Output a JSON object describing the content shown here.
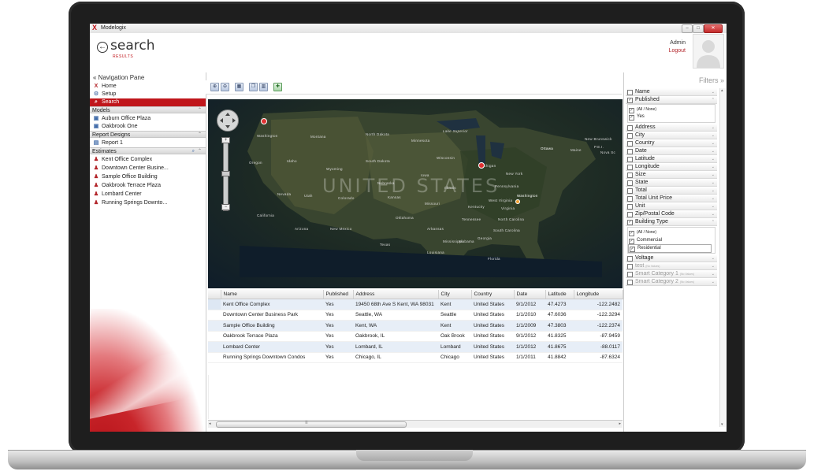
{
  "window": {
    "title": "Modelogix",
    "min": "–",
    "max": "□",
    "close": "✕"
  },
  "header": {
    "title": "search",
    "subtitle": "RESULTS",
    "user": "Admin",
    "logout": "Logout"
  },
  "nav": {
    "pane_title": "« Navigation Pane",
    "top_items": [
      {
        "label": "Home"
      },
      {
        "label": "Setup"
      },
      {
        "label": "Search"
      }
    ],
    "models_header": "Models",
    "models": [
      {
        "label": "Auburn Office Plaza"
      },
      {
        "label": "Oakbrook One"
      }
    ],
    "report_header": "Report Designs",
    "reports": [
      {
        "label": "Report 1"
      }
    ],
    "estimates_header": "Estimates",
    "estimates": [
      {
        "label": "Kent Office Complex"
      },
      {
        "label": "Downtown Center Busine..."
      },
      {
        "label": "Sample Office Building"
      },
      {
        "label": "Oakbrook Terrace Plaza"
      },
      {
        "label": "Lombard Center"
      },
      {
        "label": "Running Springs Downto..."
      }
    ]
  },
  "map": {
    "watermark": "UNITED STATES",
    "labels": {
      "washington": "Washington",
      "montana": "Montana",
      "north_dakota": "North Dakota",
      "minnesota": "Minnesota",
      "oregon": "Oregon",
      "idaho": "Idaho",
      "south_dakota": "South Dakota",
      "wisconsin": "Wisconsin",
      "michigan": "Michigan",
      "wyoming": "Wyoming",
      "iowa": "Iowa",
      "nebraska": "Nebraska",
      "illinois": "Illinois",
      "nevada": "Nevada",
      "utah": "Utah",
      "colorado": "Colorado",
      "kansas": "Kansas",
      "missouri": "Missouri",
      "kentucky": "Kentucky",
      "california": "California",
      "arizona": "Arizona",
      "new_mexico": "New Mexico",
      "oklahoma": "Oklahoma",
      "arkansas": "Arkansas",
      "tennessee": "Tennessee",
      "texas": "Texas",
      "louisiana": "Louisiana",
      "mississippi": "Mississippi",
      "alabama": "Alabama",
      "georgia": "Georgia",
      "florida": "Florida",
      "north_carolina": "North Carolina",
      "south_carolina": "South Carolina",
      "virginia": "Virginia",
      "pennsylvania": "Pennsylvania",
      "new_york": "New York",
      "maine": "Maine",
      "ottawa": "Ottawa",
      "lake_superior": "Lake Superior",
      "washington_dc": "Washington",
      "west_virginia": "West Virginia",
      "new_brunswick": "New Brunswick",
      "nova_scotia": "Nova Sc",
      "pei": "P.E.I."
    }
  },
  "grid": {
    "columns": [
      "Name",
      "Published",
      "Address",
      "City",
      "Country",
      "Date",
      "Latitude",
      "Longitude"
    ],
    "rows": [
      [
        "Kent Office Complex",
        "Yes",
        "19450 68th Ave S Kent, WA 98031",
        "Kent",
        "United States",
        "9/1/2012",
        "47.4273",
        "-122.2482"
      ],
      [
        "Downtown Center Business Park",
        "Yes",
        "Seattle, WA",
        "Seattle",
        "United States",
        "1/1/2010",
        "47.6036",
        "-122.3294"
      ],
      [
        "Sample Office Building",
        "Yes",
        "Kent, WA",
        "Kent",
        "United States",
        "1/1/2009",
        "47.3803",
        "-122.2374"
      ],
      [
        "Oakbrook Terrace Plaza",
        "Yes",
        "Oakbrook, IL",
        "Oak Brook",
        "United States",
        "9/1/2012",
        "41.8325",
        "-87.9459"
      ],
      [
        "Lombard Center",
        "Yes",
        "Lombard, IL",
        "Lombard",
        "United States",
        "1/1/2012",
        "41.8675",
        "-88.0117"
      ],
      [
        "Running Springs Downtown Condos",
        "Yes",
        "Chicago, IL",
        "Chicago",
        "United States",
        "1/1/2011",
        "41.8842",
        "-87.6324"
      ]
    ],
    "scroll_grip": "≡"
  },
  "filters": {
    "title": "Filters »",
    "fields": [
      {
        "label": "Name",
        "checked": false
      },
      {
        "label": "Published",
        "checked": true
      },
      {
        "label": "Address",
        "checked": false
      },
      {
        "label": "City",
        "checked": false
      },
      {
        "label": "Country",
        "checked": false
      },
      {
        "label": "Date",
        "checked": false
      },
      {
        "label": "Latitude",
        "checked": false
      },
      {
        "label": "Longitude",
        "checked": false
      },
      {
        "label": "Size",
        "checked": false
      },
      {
        "label": "State",
        "checked": false
      },
      {
        "label": "Total",
        "checked": false
      },
      {
        "label": "Total Unit Price",
        "checked": false
      },
      {
        "label": "Unit",
        "checked": false
      },
      {
        "label": "Zip/Postal Code",
        "checked": false
      },
      {
        "label": "Building Type",
        "checked": true
      },
      {
        "label": "Voltage",
        "checked": false
      },
      {
        "label": "test",
        "hint": "(No Values)",
        "checked": false
      },
      {
        "label": "Smart Category 1",
        "hint": "(No Values)",
        "checked": false
      },
      {
        "label": "Smart Category 2",
        "hint": "(No Values)",
        "checked": false
      }
    ],
    "published_options": [
      "(All / None)",
      "Yes"
    ],
    "building_type_options": [
      "(All / None)",
      "Commercial",
      "Residential"
    ]
  },
  "colors": {
    "accent": "#c0161b",
    "row_alt": "#e7eef7"
  }
}
